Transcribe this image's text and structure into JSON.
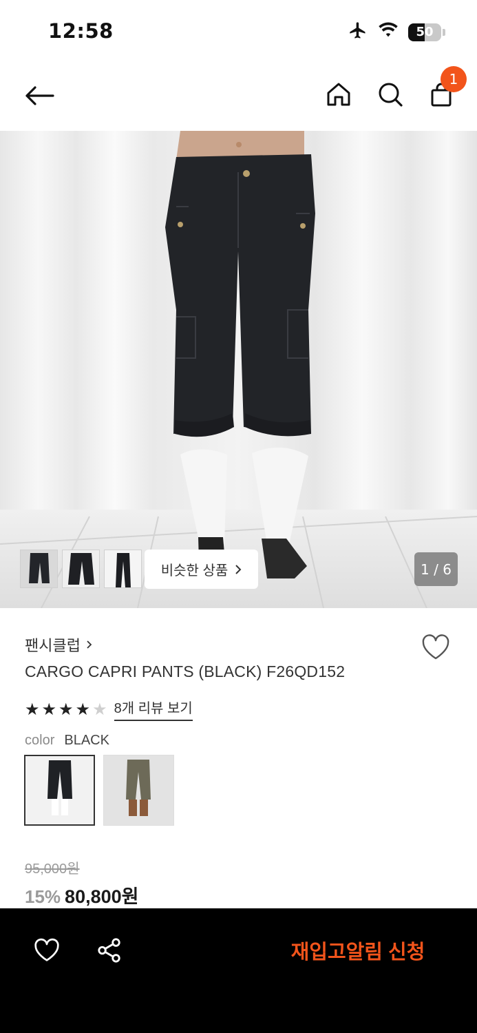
{
  "status_bar": {
    "time": "12:58",
    "battery": "50",
    "battery_level": 0.5,
    "icons": [
      "airplane-icon",
      "wifi-icon",
      "battery-icon"
    ]
  },
  "nav": {
    "icons": [
      "back-arrow-icon",
      "home-icon",
      "search-icon",
      "shopping-bag-icon"
    ],
    "cart_badge": "1"
  },
  "gallery": {
    "similar_label": "비슷한 상품",
    "counter": "1 / 6"
  },
  "product": {
    "brand": "팬시클럽",
    "title": "CARGO CAPRI PANTS (BLACK) F26QD152",
    "rating": 4,
    "rating_max": 5,
    "review_link": "8개 리뷰 보기",
    "color_label": "color",
    "color_value": "BLACK",
    "swatches": [
      "black",
      "khaki"
    ],
    "selected_swatch": "black",
    "original_price": "95,000원",
    "discount": "15%",
    "price": "80,800원"
  },
  "bottom_bar": {
    "restock_label": "재입고알림 신청",
    "icons": [
      "heart-icon",
      "share-icon"
    ]
  },
  "colors": {
    "accent": "#f2541b",
    "bottom_bar": "#000000"
  }
}
